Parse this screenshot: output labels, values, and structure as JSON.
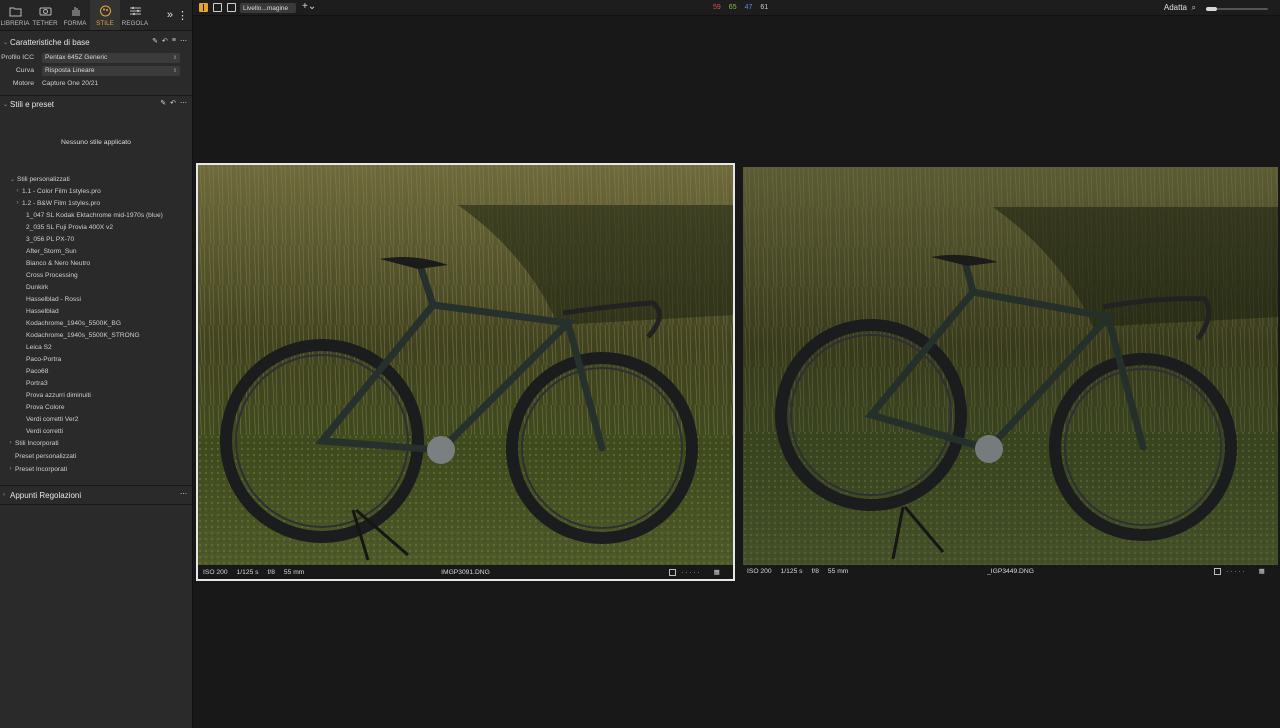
{
  "tool_tabs": [
    {
      "label": "LIBRERIA",
      "icon": "folder-icon"
    },
    {
      "label": "TETHER",
      "icon": "camera-icon"
    },
    {
      "label": "FORMA",
      "icon": "hand-icon"
    },
    {
      "label": "STILE",
      "icon": "palette-icon"
    },
    {
      "label": "REGOLA",
      "icon": "sliders-icon"
    }
  ],
  "base_section": {
    "title": "Caratteristiche di base",
    "icc_label": "Profilo ICC",
    "icc_value": "Pentax 645Z Generic",
    "curve_label": "Curva",
    "curve_value": "Risposta Lineare",
    "engine_label": "Motore",
    "engine_value": "Capture One 20/21"
  },
  "styles_section": {
    "title": "Stili e preset",
    "empty_text": "Nessuno stile applicato",
    "user_styles_label": "Stili personalizzati",
    "user_styles": [
      "1.1 - Color Film 1styles.pro",
      "1.2 - B&W Film 1styles.pro",
      "1_047 SL Kodak Ektachrome mid-1970s (blue)",
      "2_035 SL Fuji Provia 400X v2",
      "3_056 PL PX-70",
      "After_Storm_Sun",
      "Bianco & Nero Neutro",
      "Cross Processing",
      "Dunkirk",
      "Hasselblad - Rossi",
      "Hasselblad",
      "Kodachrome_1940s_5500K_BG",
      "Kodachrome_1940s_5500K_STRONG",
      "Leica S2",
      "Paco-Portra",
      "Paco68",
      "Portra3",
      "Prova azzurri diminuiti",
      "Prova Colore",
      "Verdi corretti Ver2",
      "Verdi corretti"
    ],
    "builtin_styles_label": "Stili Incorporati",
    "user_presets_label": "Preset personalizzati",
    "builtin_presets_label": "Preset Incorporati"
  },
  "notes_section": {
    "title": "Appunti Regolazioni"
  },
  "topbar": {
    "layer_select": "Livello...magine",
    "counts": [
      {
        "value": "59",
        "color": "#d9534f"
      },
      {
        "value": "65",
        "color": "#7fc24a"
      },
      {
        "value": "47",
        "color": "#5b8fe0"
      },
      {
        "value": "61",
        "color": "#cccccc"
      }
    ],
    "zoom_label": "Adatta",
    "zoom_level": 0.18
  },
  "photos": [
    {
      "iso": "ISO 200",
      "shutter": "1/125 s",
      "aperture": "f/8",
      "focal": "55 mm",
      "filename": "IMGP3091.DNG",
      "selected": true
    },
    {
      "iso": "ISO 200",
      "shutter": "1/125 s",
      "aperture": "f/8",
      "focal": "55 mm",
      "filename": "_IGP3449.DNG",
      "selected": false
    }
  ]
}
